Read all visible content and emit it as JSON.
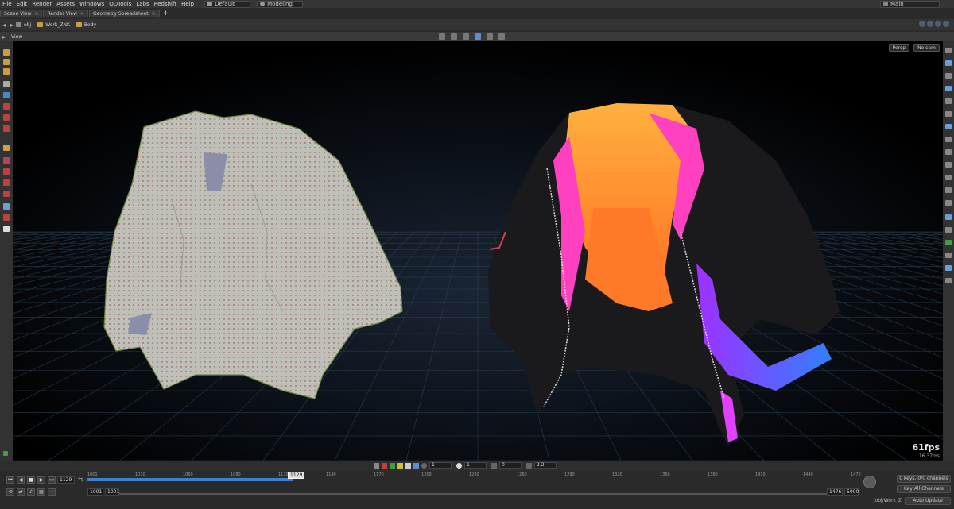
{
  "menu": [
    "File",
    "Edit",
    "Render",
    "Assets",
    "Windows",
    "ODTools",
    "Labs",
    "Redshift",
    "Help"
  ],
  "desktop": "Default",
  "mode": "Modeling",
  "main_select": "Main",
  "tabs": [
    "Scene View",
    "Render View",
    "Geometry Spreadsheet"
  ],
  "path": {
    "obj": "obj",
    "work": "Work_ZNK",
    "body": "Body"
  },
  "view_title": "View",
  "cam": {
    "persp": "Persp",
    "nocam": "No cam"
  },
  "fps": "61fps",
  "ms": "16.37ms",
  "snap": {
    "a": "1",
    "b": "1",
    "c": "0",
    "d": "2.2"
  },
  "timeline": {
    "current_frame": "1129",
    "cursor_label": "1129",
    "start": "1001",
    "start2": "1001",
    "end": "1476",
    "end2": "5000",
    "ticks": [
      "1001",
      "1030",
      "1060",
      "1080",
      "1110",
      "1140",
      "1170",
      "1200",
      "1230",
      "1260",
      "1290",
      "1320",
      "1350",
      "1380",
      "1410",
      "1440",
      "1470"
    ],
    "keys_label": "0 keys, 0/0 channels",
    "key_all": "Key All Channels",
    "auto_update": "Auto Update",
    "obj_path": "/obj/Work_Z"
  },
  "colors": {
    "accent": "#3f7fd0",
    "viewport_bg": "#000000",
    "grid": "#2a3a4a"
  }
}
